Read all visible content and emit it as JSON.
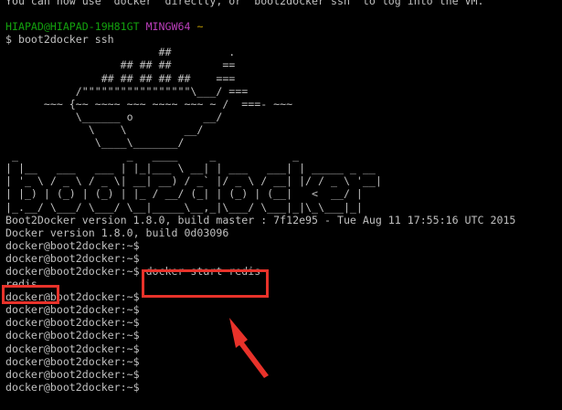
{
  "terminal": {
    "lines": {
      "l0": "You can now use `docker` directly, or `boot2docker ssh` to log into the VM.",
      "l1": "",
      "p1_user": "HIAPAD@HIAPAD-19H81GT",
      "p1_shell": "MINGW64",
      "p1_path": "~",
      "l3": "$ boot2docker ssh",
      "a1": "                        ##         .",
      "a2": "                  ## ## ##        ==",
      "a3": "               ## ## ## ## ##    ===",
      "a4": "           /\"\"\"\"\"\"\"\"\"\"\"\"\"\"\"\"\"\\___/ ===",
      "a5": "      ~~~ {~~ ~~~~ ~~~ ~~~~ ~~~ ~ /  ===- ~~~",
      "a6": "           \\______ o           __/",
      "a7": "             \\    \\         __/",
      "a8": "              \\____\\_______/",
      "b1": " _                 _   ____     _            _",
      "b2": "| |__   ___   ___ | |_|___ \\ __| | ___   ___| | _____ _ __",
      "b3": "| '_ \\ / _ \\ / _ \\| __| __) / _` |/ _ \\ / __| |/ / _ \\ '__|",
      "b4": "| |_) | (_) | (_) | |_ / __/ (_| | (_) | (__|   <  __/ |",
      "b5": "|_.__/ \\___/ \\___/ \\__|_____\\__,_|\\___/ \\___|_|\\_\\___|_|",
      "v1": "Boot2Docker version 1.8.0, build master : 7f12e95 - Tue Aug 11 17:55:16 UTC 2015",
      "v2": "Docker version 1.8.0, build 0d03096",
      "prompt": "docker@boot2docker:~$",
      "cmd": " docker start redis",
      "out": "redis"
    }
  },
  "annotation": {
    "color": "#e8322a"
  }
}
